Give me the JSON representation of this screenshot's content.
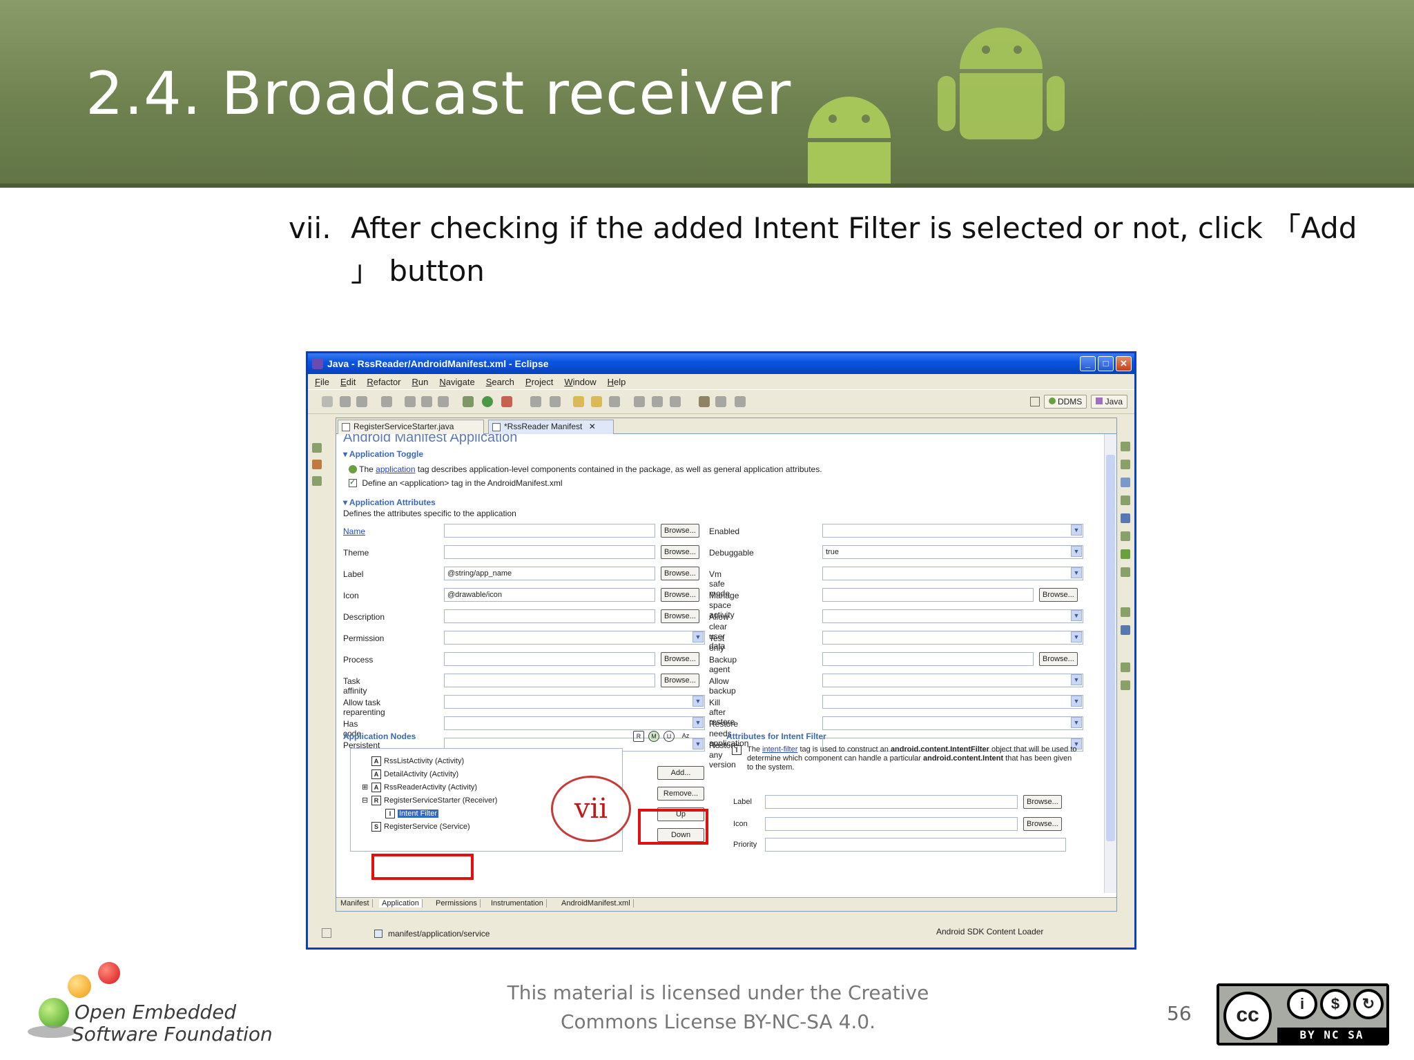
{
  "slide": {
    "title": "2.4. Broadcast receiver",
    "step_number": "vii.",
    "step_text": "After checking if the added Intent Filter is selected or not, click 「Add 」 button",
    "callout_label": "vii",
    "page_number": "56",
    "license_line1": "This material is licensed under the Creative",
    "license_line2": "Commons License BY-NC-SA 4.0.",
    "logo_line1": "Open Embedded",
    "logo_line2": "Software Foundation",
    "cc_label": "BY  NC  SA",
    "cc_symbol": "cc"
  },
  "window": {
    "title": "Java - RssReader/AndroidManifest.xml - Eclipse",
    "menu": [
      "File",
      "Edit",
      "Refactor",
      "Run",
      "Navigate",
      "Search",
      "Project",
      "Window",
      "Help"
    ],
    "perspective_ddms": "DDMS",
    "perspective_java": "Java",
    "tabs": [
      {
        "label": "RegisterServiceStarter.java"
      },
      {
        "label": "*RssReader Manifest"
      }
    ]
  },
  "editor": {
    "page_title": "Android Manifest Application",
    "toggle_heading": "Application Toggle",
    "toggle_desc_pre": "The",
    "toggle_desc_link": "application",
    "toggle_desc_post": "tag describes application-level components contained in the package, as well as general application attributes.",
    "define_check": "Define an <application> tag in the AndroidManifest.xml",
    "attributes_heading": "Application Attributes",
    "attributes_desc": "Defines the attributes specific to the application",
    "browse_label": "Browse...",
    "left_attrs": [
      {
        "label": "Name",
        "value": ""
      },
      {
        "label": "Theme",
        "value": ""
      },
      {
        "label": "Label",
        "value": "@string/app_name"
      },
      {
        "label": "Icon",
        "value": "@drawable/icon"
      },
      {
        "label": "Description",
        "value": ""
      },
      {
        "label": "Permission",
        "value": ""
      },
      {
        "label": "Process",
        "value": ""
      },
      {
        "label": "Task affinity",
        "value": ""
      },
      {
        "label": "Allow task reparenting",
        "value": ""
      },
      {
        "label": "Has code",
        "value": ""
      },
      {
        "label": "Persistent",
        "value": ""
      }
    ],
    "right_attrs": [
      {
        "label": "Enabled",
        "value": ""
      },
      {
        "label": "Debuggable",
        "value": "true"
      },
      {
        "label": "Vm safe mode",
        "value": ""
      },
      {
        "label": "Manage space activity",
        "value": ""
      },
      {
        "label": "Allow clear user data",
        "value": ""
      },
      {
        "label": "Test only",
        "value": ""
      },
      {
        "label": "Backup agent",
        "value": ""
      },
      {
        "label": "Allow backup",
        "value": ""
      },
      {
        "label": "Kill after restore",
        "value": ""
      },
      {
        "label": "Restore needs application",
        "value": ""
      },
      {
        "label": "Restore any version",
        "value": ""
      }
    ],
    "nodes_heading": "Application Nodes",
    "filter_letters": [
      "R",
      "M",
      "U",
      "Az"
    ],
    "tree": [
      {
        "kind": "A",
        "label": "RssListActivity (Activity)"
      },
      {
        "kind": "A",
        "label": "DetailActivity (Activity)"
      },
      {
        "kind": "A",
        "label": "RssReaderActivity (Activity)"
      },
      {
        "kind": "R",
        "label": "RegisterServiceStarter (Receiver)"
      },
      {
        "kind": "I",
        "label": "Intent Filter"
      },
      {
        "kind": "S",
        "label": "RegisterService (Service)"
      }
    ],
    "node_buttons": [
      "Add...",
      "Remove...",
      "Up",
      "Down"
    ],
    "intent_heading": "Attributes for Intent Filter",
    "intent_desc_pre": "The",
    "intent_desc_link": "intent-filter",
    "intent_desc_mid": "tag is used to construct an",
    "intent_desc_bold1": "android.content.IntentFilter",
    "intent_desc_mid2": "object that will be used to determine which component can handle a particular",
    "intent_desc_bold2": "android.content.Intent",
    "intent_desc_post": "that has been given to the system.",
    "intent_label": "Label",
    "intent_icon": "Icon",
    "intent_priority": "Priority",
    "bottom_tabs": [
      "Manifest",
      "Application",
      "Permissions",
      "Instrumentation",
      "AndroidManifest.xml"
    ]
  },
  "status": {
    "path": "manifest/application/service",
    "loader": "Android SDK Content Loader"
  }
}
